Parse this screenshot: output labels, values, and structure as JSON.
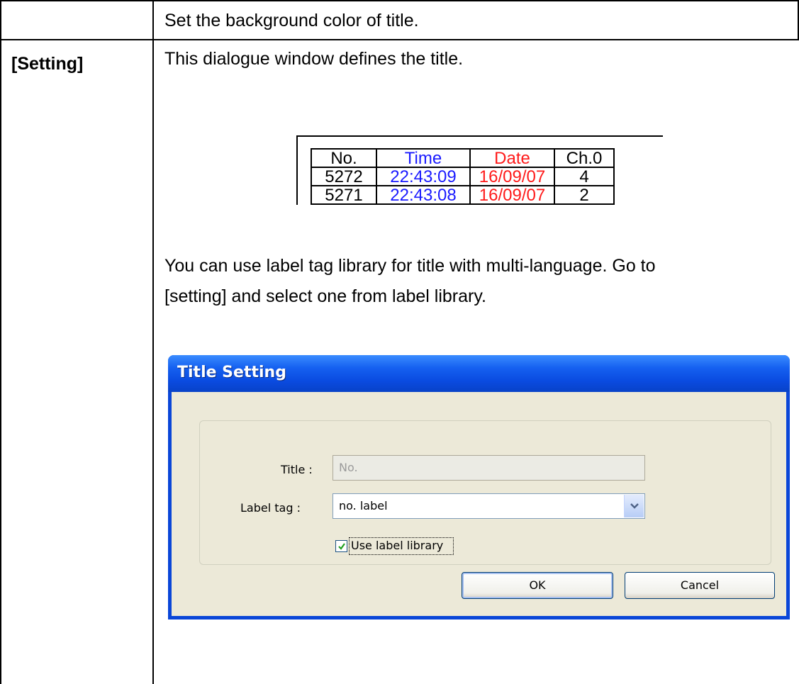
{
  "table": {
    "row1_text": "Set the background color of title.",
    "row2_label": "[Setting]",
    "row2_intro": "This dialogue window defines the title.",
    "row2_note_line1": "You can use label tag library for title with multi-language. Go to",
    "row2_note_line2": "[setting] and select one from label library."
  },
  "sample_table": {
    "headers": [
      "No.",
      "Time",
      "Date",
      "Ch.0"
    ],
    "rows": [
      [
        "5272",
        "22:43:09",
        "16/09/07",
        "4"
      ],
      [
        "5271",
        "22:43:08",
        "16/09/07",
        "2"
      ]
    ],
    "colors": {
      "time": "#1a1aff",
      "date": "#ff1a1a"
    }
  },
  "dialog": {
    "title": "Title Setting",
    "title_label": "Title :",
    "title_value": "No.",
    "label_tag_label": "Label tag :",
    "label_tag_value": "no. label",
    "checkbox_label": "Use label library",
    "checkbox_checked": true,
    "ok_label": "OK",
    "cancel_label": "Cancel",
    "colors": {
      "titlebar": "#0a46d8",
      "body": "#ece9d8"
    }
  }
}
